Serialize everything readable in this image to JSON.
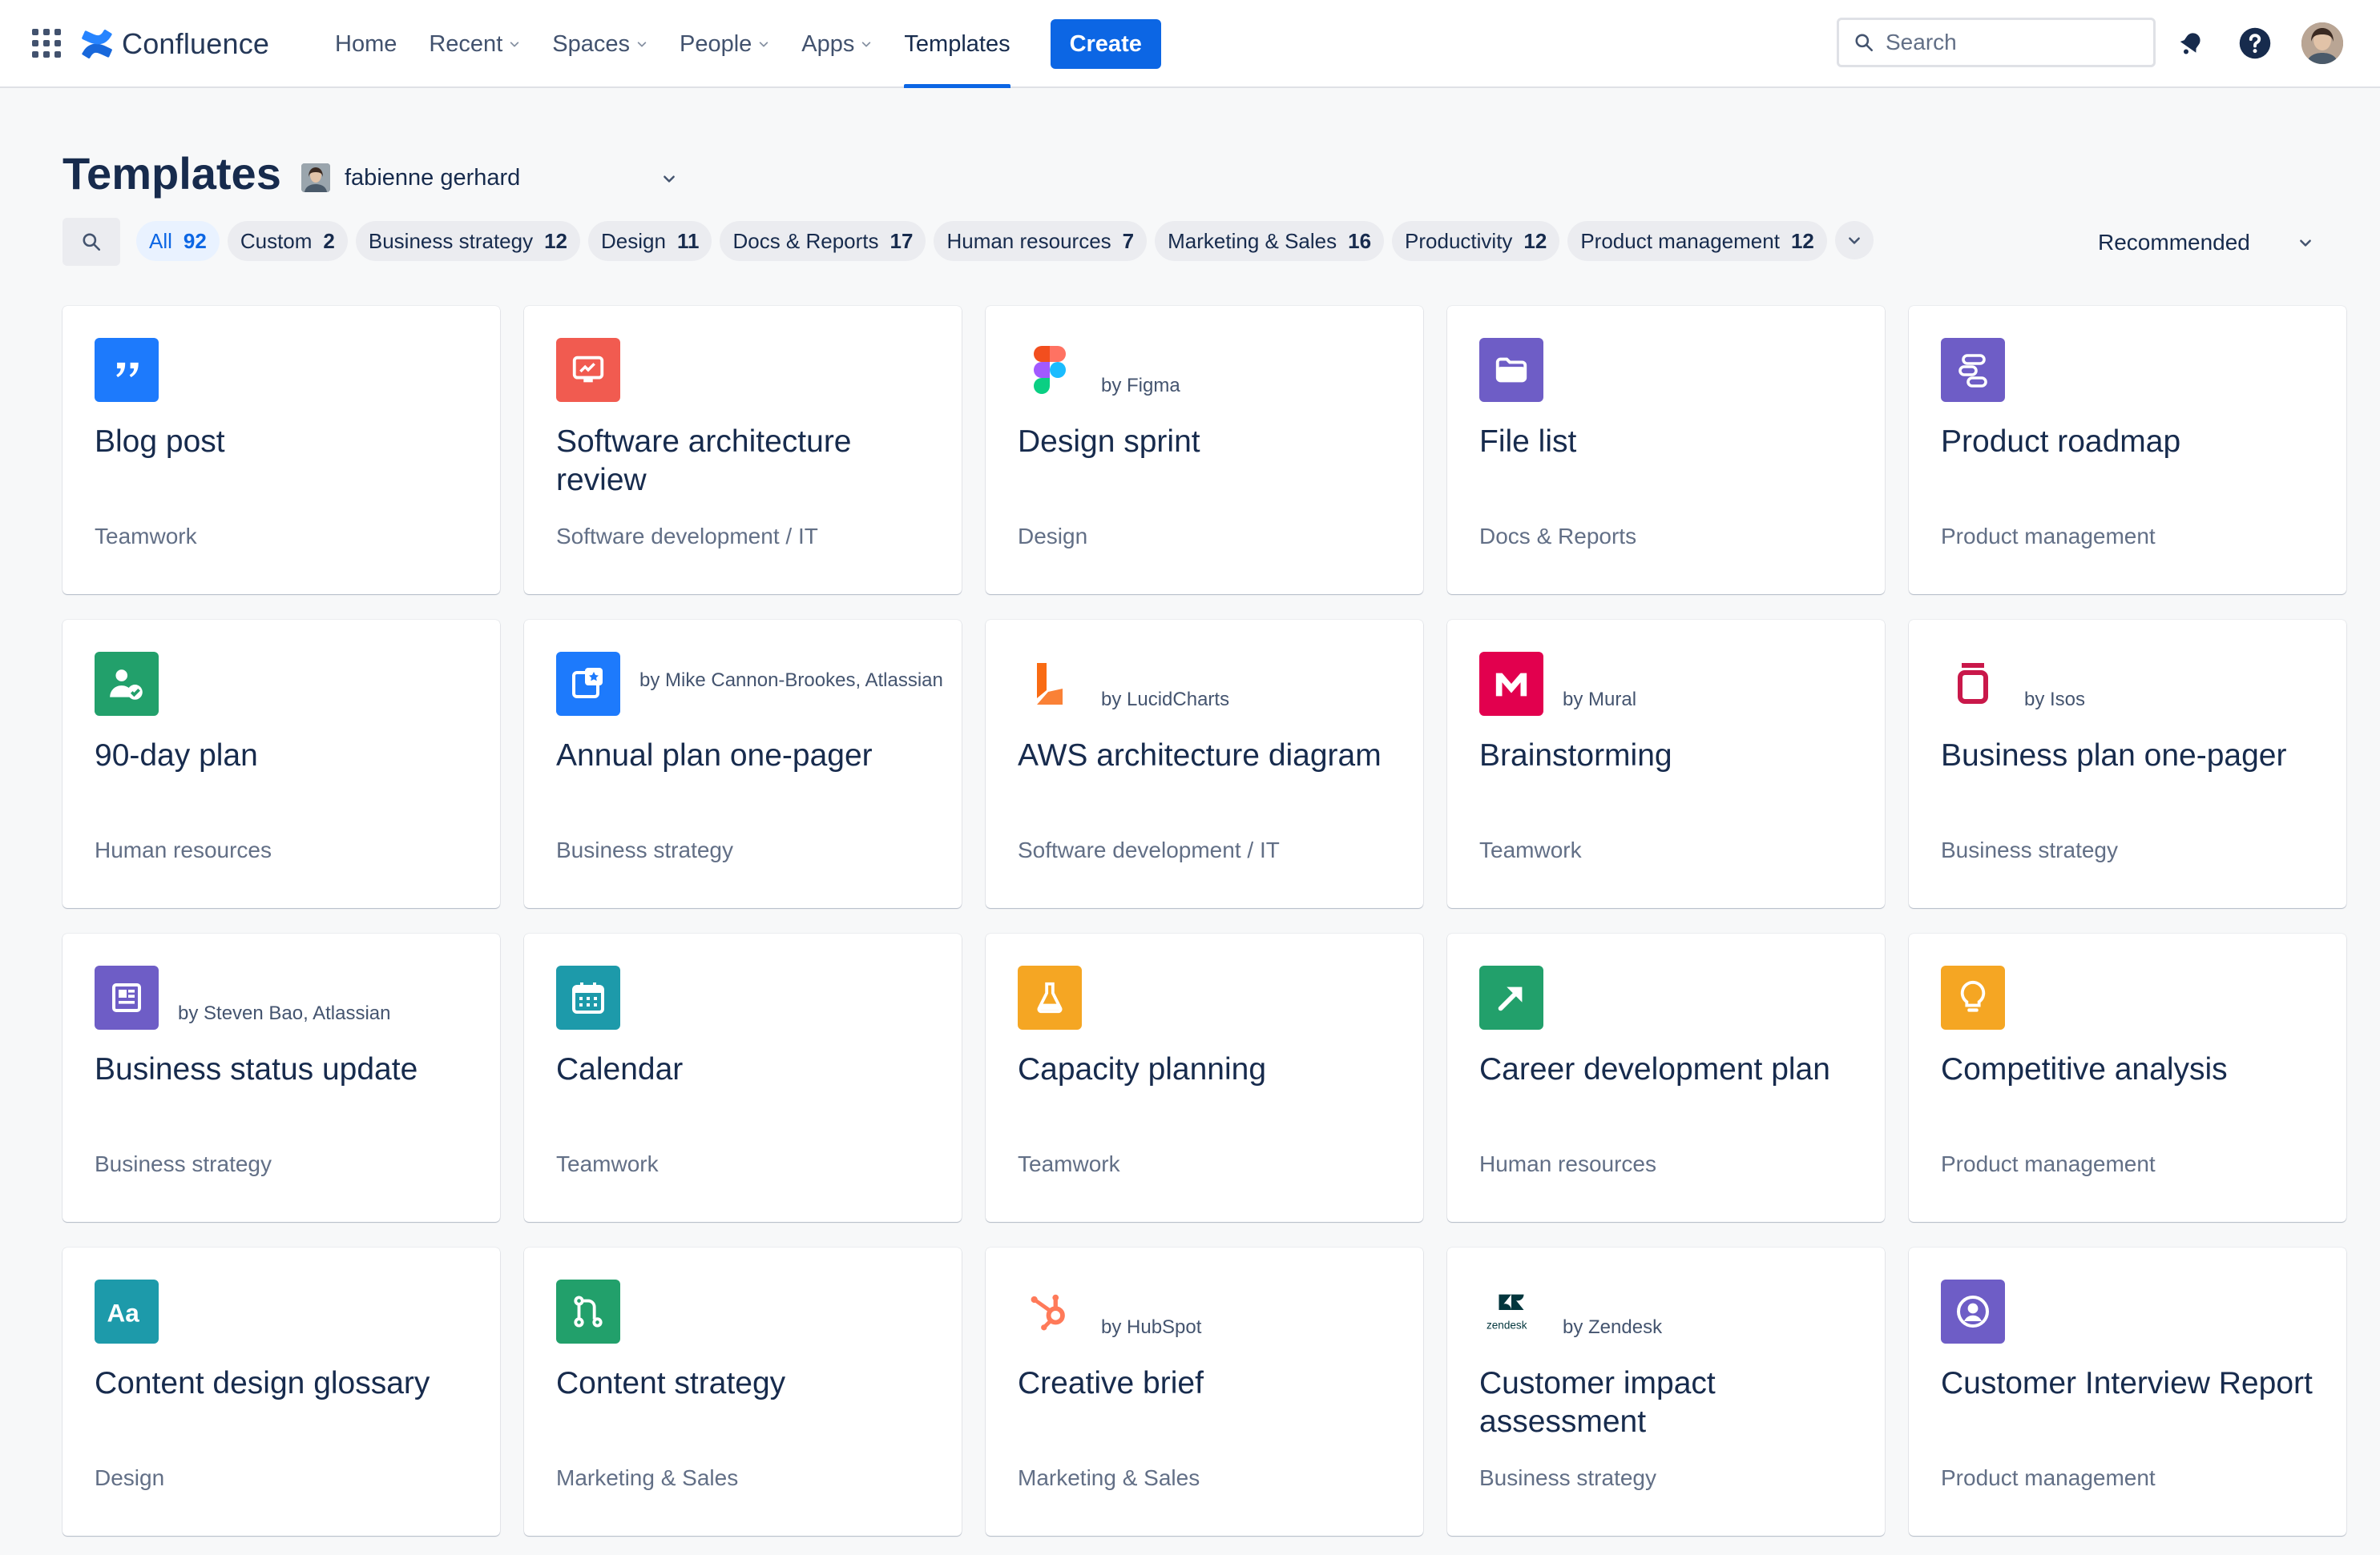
{
  "topnav": {
    "app_name": "Confluence",
    "items": [
      {
        "label": "Home",
        "dropdown": false
      },
      {
        "label": "Recent",
        "dropdown": true
      },
      {
        "label": "Spaces",
        "dropdown": true
      },
      {
        "label": "People",
        "dropdown": true
      },
      {
        "label": "Apps",
        "dropdown": true
      },
      {
        "label": "Templates",
        "dropdown": false,
        "active": true
      }
    ],
    "create_label": "Create",
    "search_placeholder": "Search",
    "icons": [
      "app-switcher-icon",
      "notifications-icon",
      "help-icon",
      "profile-avatar"
    ]
  },
  "page": {
    "title": "Templates",
    "space_owner": "fabienne gerhard"
  },
  "filters": {
    "chips": [
      {
        "label": "All",
        "count": "92",
        "active": true
      },
      {
        "label": "Custom",
        "count": "2"
      },
      {
        "label": "Business strategy",
        "count": "12"
      },
      {
        "label": "Design",
        "count": "11"
      },
      {
        "label": "Docs & Reports",
        "count": "17"
      },
      {
        "label": "Human resources",
        "count": "7"
      },
      {
        "label": "Marketing & Sales",
        "count": "16"
      },
      {
        "label": "Productivity",
        "count": "12"
      },
      {
        "label": "Product management",
        "count": "12"
      }
    ],
    "sort_label": "Recommended"
  },
  "templates": [
    {
      "title": "Blog post",
      "category": "Teamwork",
      "byline": "",
      "icon": "quote-icon",
      "color": "#1d7afc"
    },
    {
      "title": "Software architecture review",
      "category": "Software development / IT",
      "byline": "",
      "icon": "monitor-icon",
      "color": "#f15b50"
    },
    {
      "title": "Design sprint",
      "category": "Design",
      "byline": "by Figma",
      "icon": "figma-icon",
      "color": "#ffffff"
    },
    {
      "title": "File list",
      "category": "Docs & Reports",
      "byline": "",
      "icon": "folder-icon",
      "color": "#6e5dc6"
    },
    {
      "title": "Product roadmap",
      "category": "Product management",
      "byline": "",
      "icon": "roadmap-icon",
      "color": "#6e5dc6"
    },
    {
      "title": "90-day plan",
      "category": "Human resources",
      "byline": "",
      "icon": "person-check-icon",
      "color": "#22a06b"
    },
    {
      "title": "Annual plan one-pager",
      "category": "Business strategy",
      "byline": "by Mike Cannon-Brookes, Atlassian",
      "icon": "star-board-icon",
      "color": "#1d7afc"
    },
    {
      "title": "AWS architecture diagram",
      "category": "Software development / IT",
      "byline": "by LucidCharts",
      "icon": "lucid-icon",
      "color": "#ffffff"
    },
    {
      "title": "Brainstorming",
      "category": "Teamwork",
      "byline": "by Mural",
      "icon": "mural-icon",
      "color": "#e2004e"
    },
    {
      "title": "Business plan one-pager",
      "category": "Business strategy",
      "byline": "by Isos",
      "icon": "isos-icon",
      "color": "#ffffff"
    },
    {
      "title": "Business status update",
      "category": "Business strategy",
      "byline": "by Steven Bao, Atlassian",
      "icon": "newspaper-icon",
      "color": "#6e5dc6"
    },
    {
      "title": "Calendar",
      "category": "Teamwork",
      "byline": "",
      "icon": "calendar-icon",
      "color": "#1d9aaa"
    },
    {
      "title": "Capacity planning",
      "category": "Teamwork",
      "byline": "",
      "icon": "flask-icon",
      "color": "#f5a623"
    },
    {
      "title": "Career development plan",
      "category": "Human resources",
      "byline": "",
      "icon": "arrow-up-right-icon",
      "color": "#22a06b"
    },
    {
      "title": "Competitive analysis",
      "category": "Product management",
      "byline": "",
      "icon": "lightbulb-icon",
      "color": "#f5a623"
    },
    {
      "title": "Content design glossary",
      "category": "Design",
      "byline": "",
      "icon": "typography-icon",
      "color": "#1d9aaa"
    },
    {
      "title": "Content strategy",
      "category": "Marketing & Sales",
      "byline": "",
      "icon": "branch-icon",
      "color": "#22a06b"
    },
    {
      "title": "Creative brief",
      "category": "Marketing & Sales",
      "byline": "by HubSpot",
      "icon": "hubspot-icon",
      "color": "#ffffff"
    },
    {
      "title": "Customer impact assessment",
      "category": "Business strategy",
      "byline": "by Zendesk",
      "icon": "zendesk-icon",
      "color": "#ffffff"
    },
    {
      "title": "Customer Interview Report",
      "category": "Product management",
      "byline": "",
      "icon": "user-circle-icon",
      "color": "#6e5dc6"
    }
  ]
}
